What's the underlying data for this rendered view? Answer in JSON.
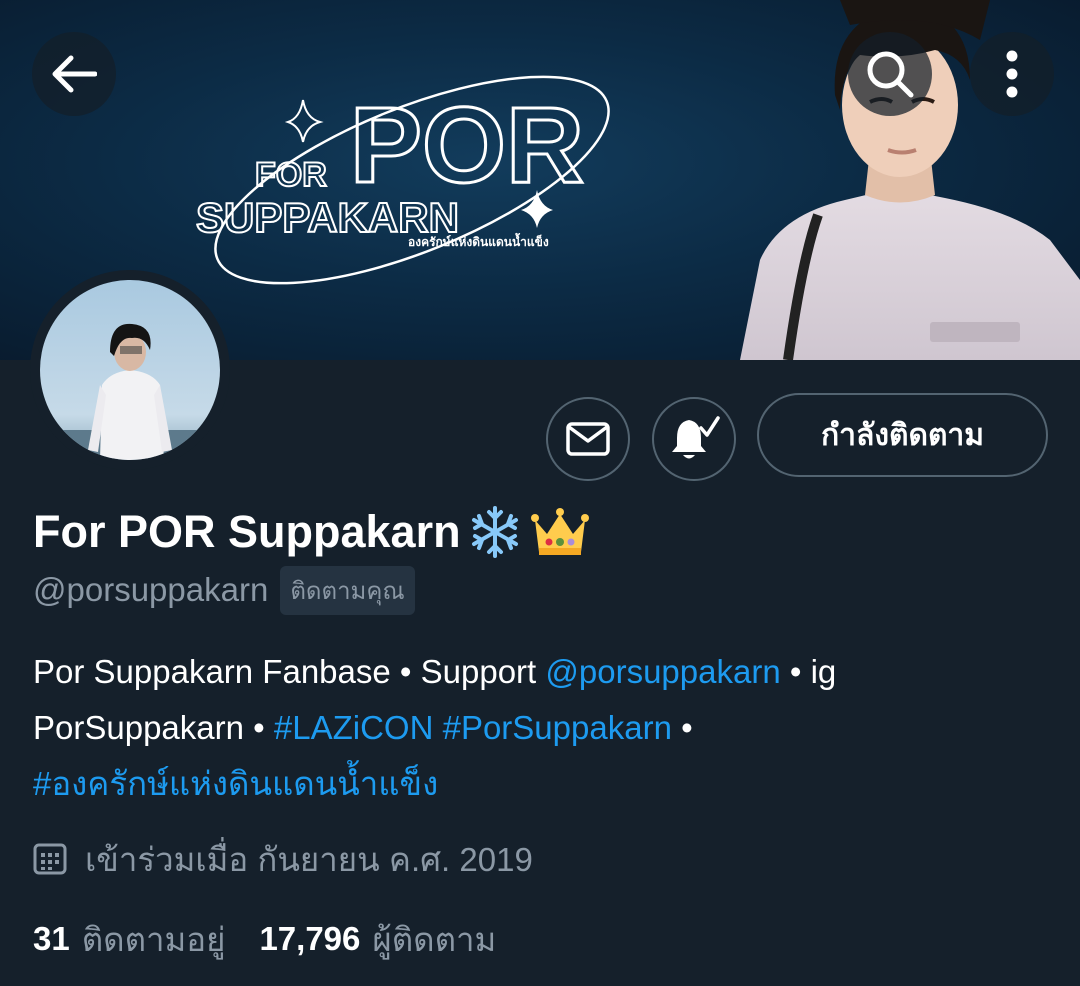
{
  "banner": {
    "title_big": "POR",
    "title_small": "FOR",
    "title_sub": "SUPPAKARN",
    "tagline": "องครักษ์แห่งดินแดนน้ำแข็ง"
  },
  "nav": {
    "back_icon": "arrow-left-icon",
    "search_icon": "search-icon",
    "more_icon": "more-vertical-icon"
  },
  "actions": {
    "message_icon": "envelope-icon",
    "notify_icon": "bell-check-icon",
    "following_label": "กำลังติดตาม"
  },
  "profile": {
    "display_name": "For POR Suppakarn",
    "name_emojis": [
      "snowflake",
      "crown"
    ],
    "handle": "@porsuppakarn",
    "follows_you": "ติดตามคุณ",
    "bio": {
      "t1": "Por Suppakarn Fanbase • Support ",
      "l1": "@porsuppakarn",
      "t2": " • ig PorSuppakarn • ",
      "l2": "#LAZiCON",
      "t3": " ",
      "l3": "#PorSuppakarn",
      "t4": " • ",
      "l4": "#องครักษ์แห่งดินแดนน้ำแข็ง"
    },
    "joined": "เข้าร่วมเมื่อ กันยายน ค.ศ. 2019",
    "following_count": "31",
    "following_label": "ติดตามอยู่",
    "followers_count": "17,796",
    "followers_label": "ผู้ติดตาม"
  },
  "colors": {
    "background": "#15202b",
    "accent": "#1d9bf0",
    "secondary_text": "#8b98a5",
    "border": "#536471"
  }
}
